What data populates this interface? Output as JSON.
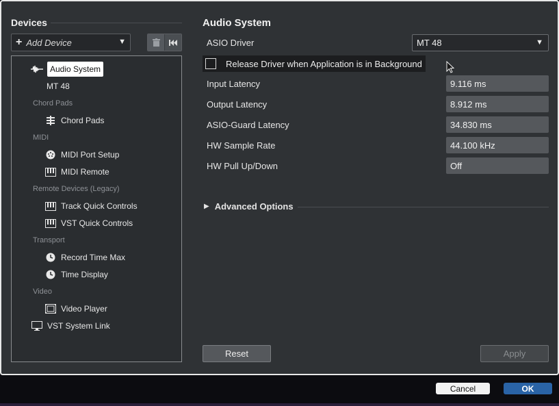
{
  "devices_panel": {
    "title": "Devices",
    "add_device_label": "Add Device",
    "tree": [
      {
        "type": "item",
        "label": "Audio System",
        "icon": "waveform-icon",
        "selected": true
      },
      {
        "type": "item",
        "label": "MT 48",
        "icon": ""
      },
      {
        "type": "category",
        "label": "Chord Pads"
      },
      {
        "type": "item",
        "label": "Chord Pads",
        "icon": "chord-pads-icon"
      },
      {
        "type": "category",
        "label": "MIDI"
      },
      {
        "type": "item",
        "label": "MIDI Port Setup",
        "icon": "midi-port-icon"
      },
      {
        "type": "item",
        "label": "MIDI Remote",
        "icon": "keyboard-icon"
      },
      {
        "type": "category",
        "label": "Remote Devices (Legacy)"
      },
      {
        "type": "item",
        "label": "Track Quick Controls",
        "icon": "keyboard-icon"
      },
      {
        "type": "item",
        "label": "VST Quick Controls",
        "icon": "keyboard-icon"
      },
      {
        "type": "category",
        "label": "Transport"
      },
      {
        "type": "item",
        "label": "Record Time Max",
        "icon": "clock-icon"
      },
      {
        "type": "item",
        "label": "Time Display",
        "icon": "clock-icon"
      },
      {
        "type": "category",
        "label": "Video"
      },
      {
        "type": "item",
        "label": "Video Player",
        "icon": "film-icon"
      },
      {
        "type": "item",
        "label": "VST System Link",
        "icon": "monitor-icon"
      }
    ]
  },
  "audio_system": {
    "title": "Audio System",
    "asio_driver_label": "ASIO Driver",
    "asio_driver_value": "MT 48",
    "release_driver_label": "Release Driver when Application is in Background",
    "release_driver_checked": false,
    "input_latency_label": "Input Latency",
    "input_latency_value": "9.116 ms",
    "output_latency_label": "Output Latency",
    "output_latency_value": "8.912 ms",
    "asio_guard_label": "ASIO-Guard Latency",
    "asio_guard_value": "34.830 ms",
    "sample_rate_label": "HW Sample Rate",
    "sample_rate_value": "44.100 kHz",
    "pull_label": "HW Pull Up/Down",
    "pull_value": "Off",
    "advanced_label": "Advanced Options",
    "reset_label": "Reset",
    "apply_label": "Apply"
  },
  "dialog": {
    "cancel_label": "Cancel",
    "ok_label": "OK"
  },
  "colors": {
    "panel_bg": "#2f3235",
    "field_bg": "#55585c",
    "ok_blue": "#2a63a6"
  }
}
